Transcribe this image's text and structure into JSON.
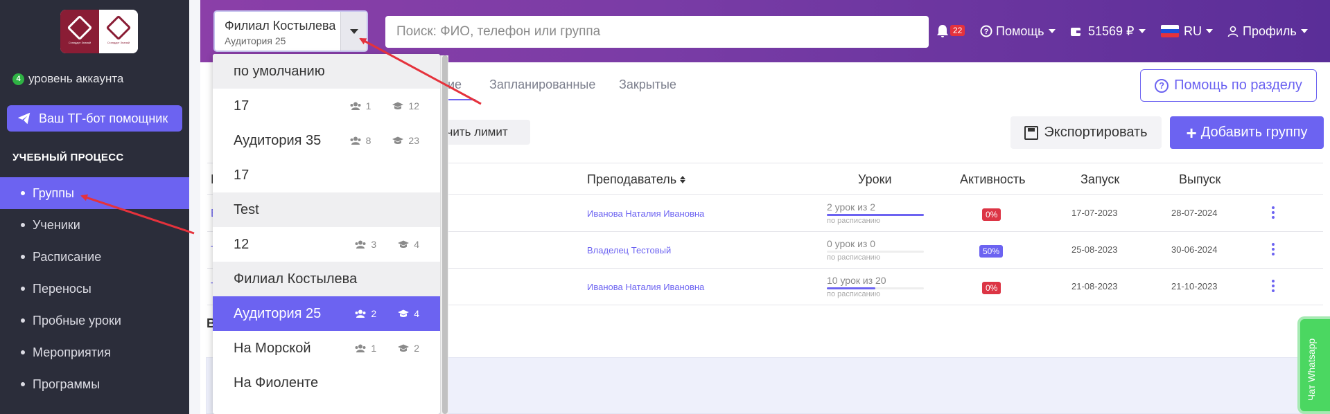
{
  "sidebar": {
    "account_level_num": "4",
    "account_level_text": "уровень аккаунта",
    "tg_button": "Ваш ТГ-бот помощник",
    "section_title": "УЧЕБНЫЙ ПРОЦЕСС",
    "items": [
      {
        "label": "Группы",
        "active": true
      },
      {
        "label": "Ученики"
      },
      {
        "label": "Расписание"
      },
      {
        "label": "Переносы"
      },
      {
        "label": "Пробные уроки"
      },
      {
        "label": "Мероприятия"
      },
      {
        "label": "Программы"
      }
    ]
  },
  "header": {
    "branch_title": "Филиал Костылева",
    "branch_sub": "Аудитория 25",
    "search_placeholder": "Поиск: ФИО, телефон или группа",
    "notifications": "22",
    "help": "Помощь",
    "balance": "51569 ₽",
    "lang": "RU",
    "profile": "Профиль"
  },
  "tabs": [
    "ние",
    "Запланированные",
    "Закрытые"
  ],
  "help_section": "Помощь по разделу",
  "limit_button": "ичить лимит",
  "export_button": "Экспортировать",
  "add_button": "Добавить группу",
  "table": {
    "headers": {
      "teacher": "Преподаватель",
      "lessons": "Уроки",
      "activity": "Активность",
      "start": "Запуск",
      "end": "Выпуск",
      "first": "Н"
    },
    "rows": [
      {
        "edge": "E",
        "teacher": "Иванова Наталия Ивановна",
        "lessons": "2 урок из 2",
        "lessons_fill": 1.0,
        "lessons_sub": "по расписанию",
        "activity": "0%",
        "activity_color": "#dc3545",
        "start": "17-07-2023",
        "end": "28-07-2024"
      },
      {
        "edge": "T",
        "teacher": "Владелец Тестовый",
        "lessons": "0 урок из 0",
        "lessons_fill": 0.0,
        "lessons_sub": "по расписанию",
        "activity": "50%",
        "activity_color": "#6c63f1",
        "start": "25-08-2023",
        "end": "30-06-2024"
      },
      {
        "edge": "T",
        "teacher": "Иванова Наталия Ивановна",
        "lessons": "10 урок из 20",
        "lessons_fill": 0.5,
        "lessons_sub": "по расписанию",
        "activity": "0%",
        "activity_color": "#dc3545",
        "start": "21-08-2023",
        "end": "21-10-2023"
      }
    ]
  },
  "row_letter": "В",
  "whatsapp": "Чат Whatsapp",
  "dropdown": [
    {
      "label": "по умолчанию",
      "header": true
    },
    {
      "label": "17",
      "students": "1",
      "teachers": "12"
    },
    {
      "label": "Аудитория 35",
      "students": "8",
      "teachers": "23"
    },
    {
      "label": "17"
    },
    {
      "label": "Test",
      "header": true
    },
    {
      "label": "12",
      "students": "3",
      "teachers": "4"
    },
    {
      "label": "Филиал Костылева",
      "header": true
    },
    {
      "label": "Аудитория 25",
      "students": "2",
      "teachers": "4",
      "selected": true
    },
    {
      "label": "На Морской",
      "students": "1",
      "teachers": "2"
    },
    {
      "label": "На Фиоленте"
    }
  ],
  "colors": {
    "accent": "#6c63f1",
    "sidebar": "#2b2d3a",
    "annotation_arrow": "#e5323c"
  }
}
